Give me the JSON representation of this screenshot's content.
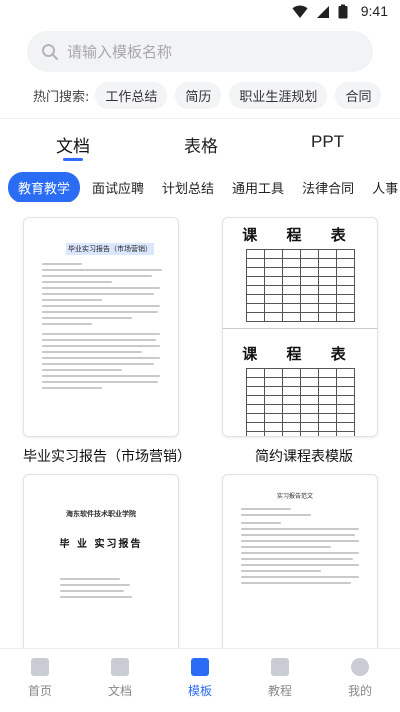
{
  "status": {
    "time": "9:41"
  },
  "search": {
    "placeholder": "请输入模板名称"
  },
  "hot": {
    "label": "热门搜索:",
    "tags": [
      "工作总结",
      "简历",
      "职业生涯规划",
      "合同"
    ]
  },
  "main_tabs": [
    "文档",
    "表格",
    "PPT"
  ],
  "categories": [
    "教育教学",
    "面试应聘",
    "计划总结",
    "通用工具",
    "法律合同",
    "人事"
  ],
  "templates": [
    {
      "title": "毕业实习报告（市场营销）",
      "doc_heading": "毕业实习报告（市场营销）"
    },
    {
      "title": "简约课程表模版",
      "doc_heading": "课 程 表",
      "doc_heading2": "课 程 表"
    },
    {
      "doc_heading": "毕 业 实习报告",
      "school": "海东软件技术职业学院"
    },
    {
      "doc_heading": "实习报告范文"
    }
  ],
  "nav": [
    "首页",
    "文档",
    "模板",
    "教程",
    "我的"
  ],
  "colors": {
    "accent": "#2a6df4"
  }
}
